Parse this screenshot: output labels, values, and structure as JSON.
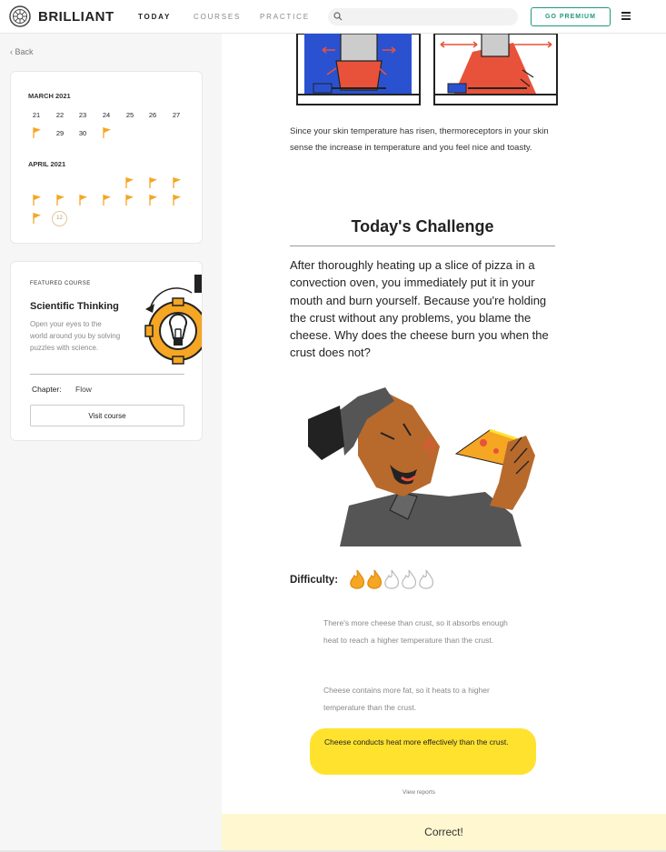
{
  "app": {
    "brand": "BRILLIANT",
    "nav": [
      {
        "label": "TODAY",
        "active": true
      },
      {
        "label": "COURSES",
        "active": false
      },
      {
        "label": "PRACTICE",
        "active": false
      }
    ],
    "search_placeholder": "",
    "premium_label": "GO PREMIUM",
    "accent_color": "#1e9a7d"
  },
  "sidebar": {
    "back_label": "Back",
    "calendar": {
      "months": [
        {
          "name": "MARCH 2021",
          "row1": [
            "21",
            "22",
            "23",
            "24",
            "25",
            "26",
            "27"
          ],
          "row2": [
            "",
            "29",
            "30",
            ""
          ]
        },
        {
          "name": "APRIL 2021",
          "today": "12"
        }
      ],
      "flag_color": "#f5a623"
    },
    "featured": {
      "label": "FEATURED COURSE",
      "title": "Scientific Thinking",
      "description": "Open your eyes to the world around you by solving puzzles with science.",
      "chapter_label": "Chapter:",
      "chapter_value": "Flow",
      "button_label": "Visit course"
    }
  },
  "main": {
    "intro_text": "Since your skin temperature has risen, thermoreceptors in your skin sense the increase in temperature and you feel nice and toasty.",
    "challenge_title": "Today's Challenge",
    "question": "After thoroughly heating up a slice of pizza in a convection oven, you immediately put it in your mouth and burn yourself. Because you're holding the crust without any problems, you blame the cheese. Why does the cheese burn you when the crust does not?",
    "difficulty_label": "Difficulty:",
    "difficulty": {
      "level": 2,
      "max": 5
    },
    "options": [
      {
        "text": "There's more cheese than crust, so it absorbs enough heat to reach a higher temperature than the crust.",
        "selected": false
      },
      {
        "text": "Cheese contains more fat, so it heats to a higher temperature than the crust.",
        "selected": false
      },
      {
        "text": "Cheese conducts heat more effectively than the crust.",
        "selected": true
      }
    ],
    "view_reports": "View reports",
    "result": "Correct!",
    "selected_color": "#ffe22e",
    "result_bg": "#fff7cf"
  }
}
